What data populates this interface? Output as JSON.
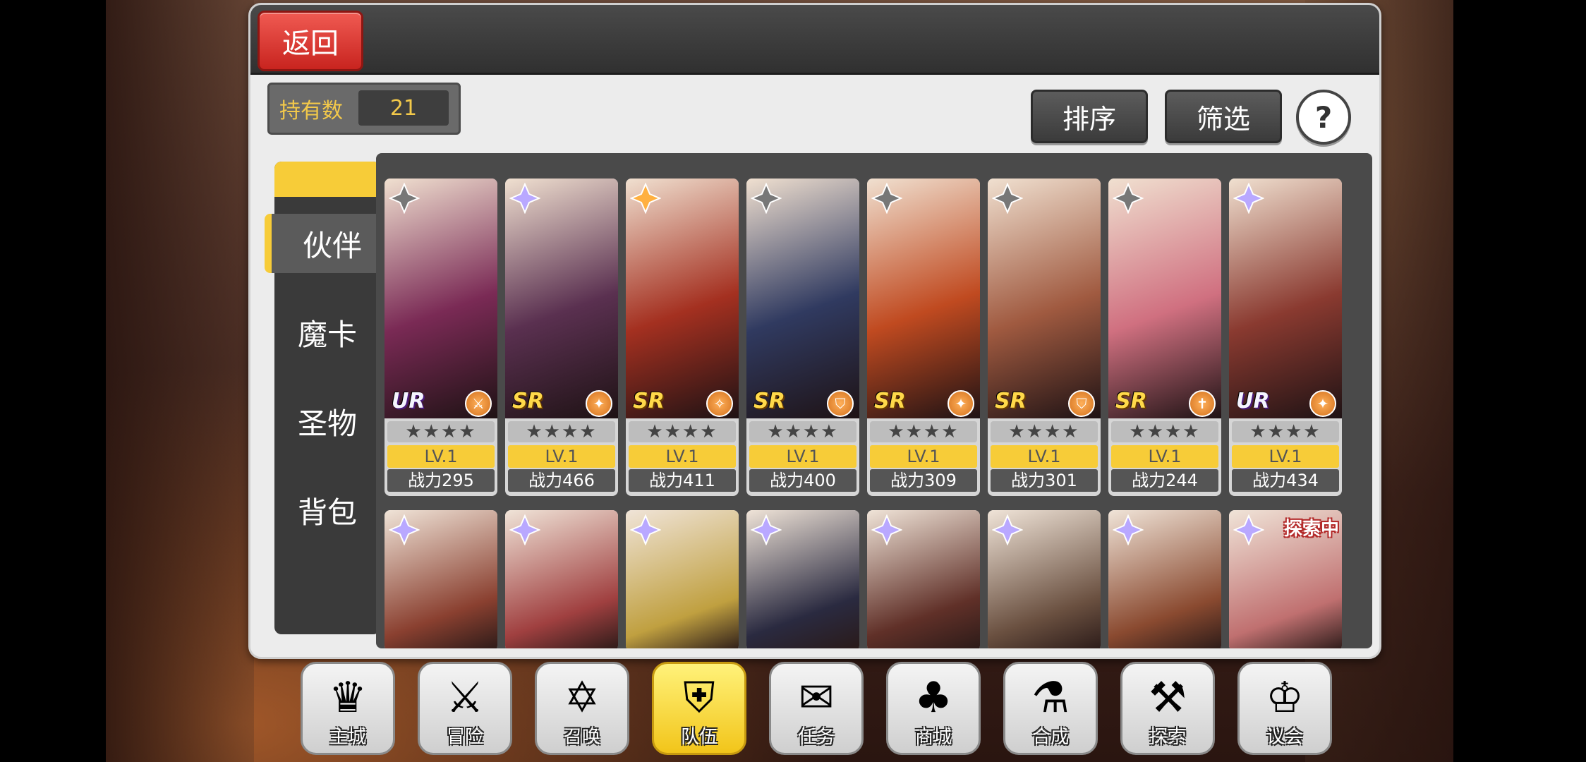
{
  "header": {
    "back_label": "返回"
  },
  "owned": {
    "label": "持有数",
    "value": "21"
  },
  "toolbar": {
    "sort_label": "排序",
    "filter_label": "筛选",
    "help_label": "?"
  },
  "tabs": [
    {
      "label": "伙伴",
      "active": true
    },
    {
      "label": "魔卡",
      "active": false
    },
    {
      "label": "圣物",
      "active": false
    },
    {
      "label": "背包",
      "active": false
    }
  ],
  "cards_row1": [
    {
      "rarity": "UR",
      "stars": "★★★★",
      "level": "LV.1",
      "power": "战力295",
      "element": "dark-element-icon",
      "role": "attack-role-icon",
      "color": "#7a2a55"
    },
    {
      "rarity": "SR",
      "stars": "★★★★",
      "level": "LV.1",
      "power": "战力466",
      "element": "light-element-icon",
      "role": "support-role-icon",
      "color": "#5a3050"
    },
    {
      "rarity": "SR",
      "stars": "★★★★",
      "level": "LV.1",
      "power": "战力411",
      "element": "fire-element-icon",
      "role": "magic-role-icon",
      "color": "#a43020"
    },
    {
      "rarity": "SR",
      "stars": "★★★★",
      "level": "LV.1",
      "power": "战力400",
      "element": "dark-element-icon",
      "role": "defense-role-icon",
      "color": "#303a60"
    },
    {
      "rarity": "SR",
      "stars": "★★★★",
      "level": "LV.1",
      "power": "战力309",
      "element": "dark-element-icon",
      "role": "support-role-icon",
      "color": "#c04a20"
    },
    {
      "rarity": "SR",
      "stars": "★★★★",
      "level": "LV.1",
      "power": "战力301",
      "element": "dark-element-icon",
      "role": "defense-role-icon",
      "color": "#a05a40"
    },
    {
      "rarity": "SR",
      "stars": "★★★★",
      "level": "LV.1",
      "power": "战力244",
      "element": "dark-element-icon",
      "role": "healer-role-icon",
      "color": "#d07080"
    },
    {
      "rarity": "UR",
      "stars": "★★★★",
      "level": "LV.1",
      "power": "战力434",
      "element": "light-element-icon",
      "role": "support-role-icon",
      "color": "#8a3a30"
    }
  ],
  "cards_row2": [
    {
      "color": "#8a4030",
      "element": "light-element-icon",
      "tag": ""
    },
    {
      "color": "#a04040",
      "element": "light-element-icon",
      "tag": ""
    },
    {
      "color": "#c0a040",
      "element": "light-element-icon",
      "tag": ""
    },
    {
      "color": "#2a2a40",
      "element": "light-element-icon",
      "tag": ""
    },
    {
      "color": "#603028",
      "element": "light-element-icon",
      "tag": ""
    },
    {
      "color": "#6a5040",
      "element": "light-element-icon",
      "tag": ""
    },
    {
      "color": "#8a4a30",
      "element": "light-element-icon",
      "tag": ""
    },
    {
      "color": "#c07070",
      "element": "light-element-icon",
      "tag": "探索中"
    }
  ],
  "nav": [
    {
      "label": "主城",
      "icon": "crown-icon",
      "glyph": "♛"
    },
    {
      "label": "冒险",
      "icon": "crossed-swords-icon",
      "glyph": "⚔"
    },
    {
      "label": "召唤",
      "icon": "summon-card-icon",
      "glyph": "✡"
    },
    {
      "label": "队伍",
      "icon": "team-crest-icon",
      "glyph": "⛨",
      "active": true
    },
    {
      "label": "任务",
      "icon": "quest-book-icon",
      "glyph": "✉"
    },
    {
      "label": "商城",
      "icon": "shop-tree-icon",
      "glyph": "♣"
    },
    {
      "label": "合成",
      "icon": "potion-icon",
      "glyph": "⚗"
    },
    {
      "label": "探索",
      "icon": "explore-shovel-icon",
      "glyph": "⚒"
    },
    {
      "label": "议会",
      "icon": "council-emblem-icon",
      "glyph": "♔"
    }
  ]
}
